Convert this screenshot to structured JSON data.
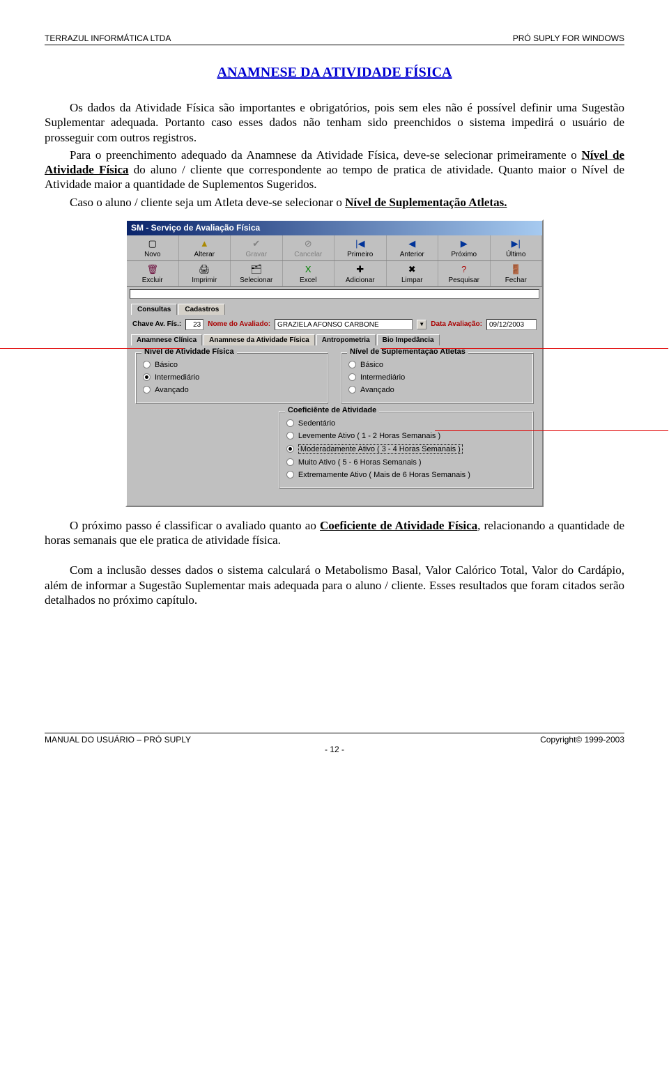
{
  "header": {
    "left": "TERRAZUL INFORMÁTICA LTDA",
    "right": "PRÓ SUPLY FOR WINDOWS"
  },
  "title": "ANAMNESE DA ATIVIDADE FÍSICA",
  "paragraphs": {
    "p1": "Os dados da Atividade Física são importantes e obrigatórios, pois sem eles não é possível definir uma Sugestão Suplementar adequada. Portanto caso esses dados não tenham sido preenchidos o sistema impedirá o usuário de prosseguir com outros registros.",
    "p2a": "Para o preenchimento adequado da Anamnese da Atividade Física, deve-se selecionar primeiramente o ",
    "p2_u": "Nível de Atividade Física",
    "p2b": " do aluno / cliente que correspondente ao tempo de pratica de atividade. Quanto maior o Nível de Atividade maior a quantidade de Suplementos Sugeridos.",
    "p3a": "Caso o aluno / cliente seja um Atleta deve-se selecionar o ",
    "p3_u": "Nível de Suplementação Atletas.",
    "p4a": "O próximo passo é classificar o avaliado quanto ao ",
    "p4_u": "Coeficiente de Atividade Física",
    "p4b": ", relacionando a quantidade de horas semanais que ele pratica de atividade física.",
    "p5": "Com a inclusão desses dados o sistema calculará o Metabolismo Basal, Valor Calórico Total, Valor do Cardápio, além de informar a Sugestão Suplementar mais adequada para o aluno / cliente. Esses resultados que foram citados serão detalhados no próximo capítulo."
  },
  "win": {
    "title": "SM - Serviço de Avaliação Física",
    "toolbar1": [
      {
        "label": "Novo",
        "icon": "▢",
        "cls": ""
      },
      {
        "label": "Alterar",
        "icon": "▲",
        "cls": "yellow"
      },
      {
        "label": "Gravar",
        "icon": "✔",
        "cls": "disabled"
      },
      {
        "label": "Cancelar",
        "icon": "⊘",
        "cls": "disabled"
      },
      {
        "label": "Primeiro",
        "icon": "|◀",
        "cls": "blue"
      },
      {
        "label": "Anterior",
        "icon": "◀",
        "cls": "blue"
      },
      {
        "label": "Próximo",
        "icon": "▶",
        "cls": "blue"
      },
      {
        "label": "Último",
        "icon": "▶|",
        "cls": "blue"
      }
    ],
    "toolbar2": [
      {
        "label": "Excluir",
        "icon": "🗑",
        "cls": "maroon"
      },
      {
        "label": "Imprimir",
        "icon": "🖨",
        "cls": ""
      },
      {
        "label": "Selecionar",
        "icon": "🗂",
        "cls": ""
      },
      {
        "label": "Excel",
        "icon": "X",
        "cls": "green"
      },
      {
        "label": "Adicionar",
        "icon": "✚",
        "cls": ""
      },
      {
        "label": "Limpar",
        "icon": "✖",
        "cls": ""
      },
      {
        "label": "Pesquisar",
        "icon": "?",
        "cls": "red"
      },
      {
        "label": "Fechar",
        "icon": "🚪",
        "cls": ""
      }
    ],
    "tabs": {
      "t1": "Consultas",
      "t2": "Cadastros"
    },
    "form": {
      "key_label": "Chave Av. Fís.:",
      "key_value": "23",
      "name_label": "Nome do Avaliado:",
      "name_value": "GRAZIELA AFONSO CARBONE",
      "date_label": "Data Avaliação:",
      "date_value": "09/12/2003"
    },
    "subtabs": {
      "s1": "Anamnese Clínica",
      "s2": "Anamnese da Atividade Física",
      "s3": "Antropometria",
      "s4": "Bio Impedância"
    },
    "group_nivel": {
      "legend": "Nível de Atividade Física",
      "o1": "Básico",
      "o2": "Intermediário",
      "o3": "Avançado",
      "sel": "o2"
    },
    "group_supl": {
      "legend": "Nível de Suplementação Atletas",
      "o1": "Básico",
      "o2": "Intermediário",
      "o3": "Avançado",
      "sel": ""
    },
    "group_coef": {
      "legend": "Coeficiênte de Atividade",
      "o1": "Sedentário",
      "o2": "Levemente Ativo ( 1 - 2 Horas Semanais )",
      "o3": "Moderadamente Ativo ( 3 - 4 Horas Semanais )",
      "o4": "Muito Ativo ( 5 - 6 Horas Semanais )",
      "o5": "Extremamente Ativo ( Mais de 6 Horas Semanais )",
      "sel": "o3"
    }
  },
  "footer": {
    "left": "MANUAL DO USUÁRIO – PRÓ SUPLY",
    "right": "Copyright© 1999-2003",
    "page": "- 12 -"
  }
}
